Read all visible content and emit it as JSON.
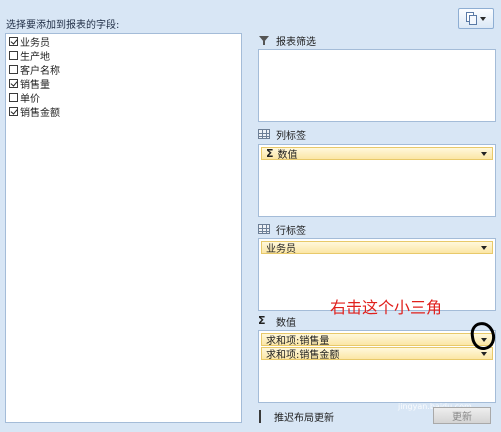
{
  "header": {
    "label": "选择要添加到报表的字段:"
  },
  "fields": [
    {
      "label": "业务员",
      "checked": true
    },
    {
      "label": "生产地",
      "checked": false
    },
    {
      "label": "客户名称",
      "checked": false
    },
    {
      "label": "销售量",
      "checked": true
    },
    {
      "label": "单价",
      "checked": false
    },
    {
      "label": "销售金额",
      "checked": true
    }
  ],
  "areas": {
    "filter": {
      "title": "报表筛选",
      "icon": "funnel-icon"
    },
    "columns": {
      "title": "列标签",
      "icon": "grid-icon",
      "items": [
        "数值"
      ]
    },
    "rows": {
      "title": "行标签",
      "icon": "grid-icon",
      "items": [
        "业务员"
      ]
    },
    "values": {
      "title": "数值",
      "icon": "sigma-icon",
      "items": [
        "求和项:销售量",
        "求和项:销售金额"
      ]
    }
  },
  "annotation": {
    "text": "右击这个小三角"
  },
  "footer": {
    "defer_label": "推迟布局更新",
    "update_label": "更新"
  },
  "watermark": {
    "text": "Baidu 经验",
    "sub": "jingyan.baidu.com"
  },
  "colors": {
    "panel_bg": "#d8e6f5",
    "pill_bg": "#fbe6a6",
    "annotation": "#e0201c"
  }
}
